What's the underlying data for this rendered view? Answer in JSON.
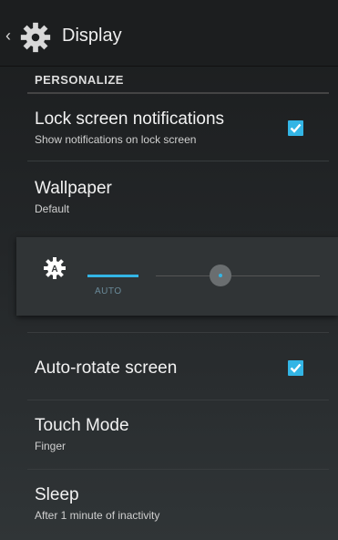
{
  "actionbar": {
    "title": "Display"
  },
  "section": {
    "header": "PERSONALIZE"
  },
  "prefs": {
    "lock_screen": {
      "title": "Lock screen notifications",
      "summary": "Show notifications on lock screen",
      "checked": true
    },
    "wallpaper": {
      "title": "Wallpaper",
      "summary": "Default"
    },
    "brightness": {
      "auto_label": "AUTO",
      "level": 0.45
    },
    "auto_rotate": {
      "title": "Auto-rotate screen",
      "checked": true
    },
    "touch_mode": {
      "title": "Touch Mode",
      "summary": "Finger"
    },
    "sleep": {
      "title": "Sleep",
      "summary": "After 1 minute of inactivity"
    }
  },
  "colors": {
    "accent": "#33b5e5",
    "background": "#232628",
    "panel": "#303436"
  }
}
